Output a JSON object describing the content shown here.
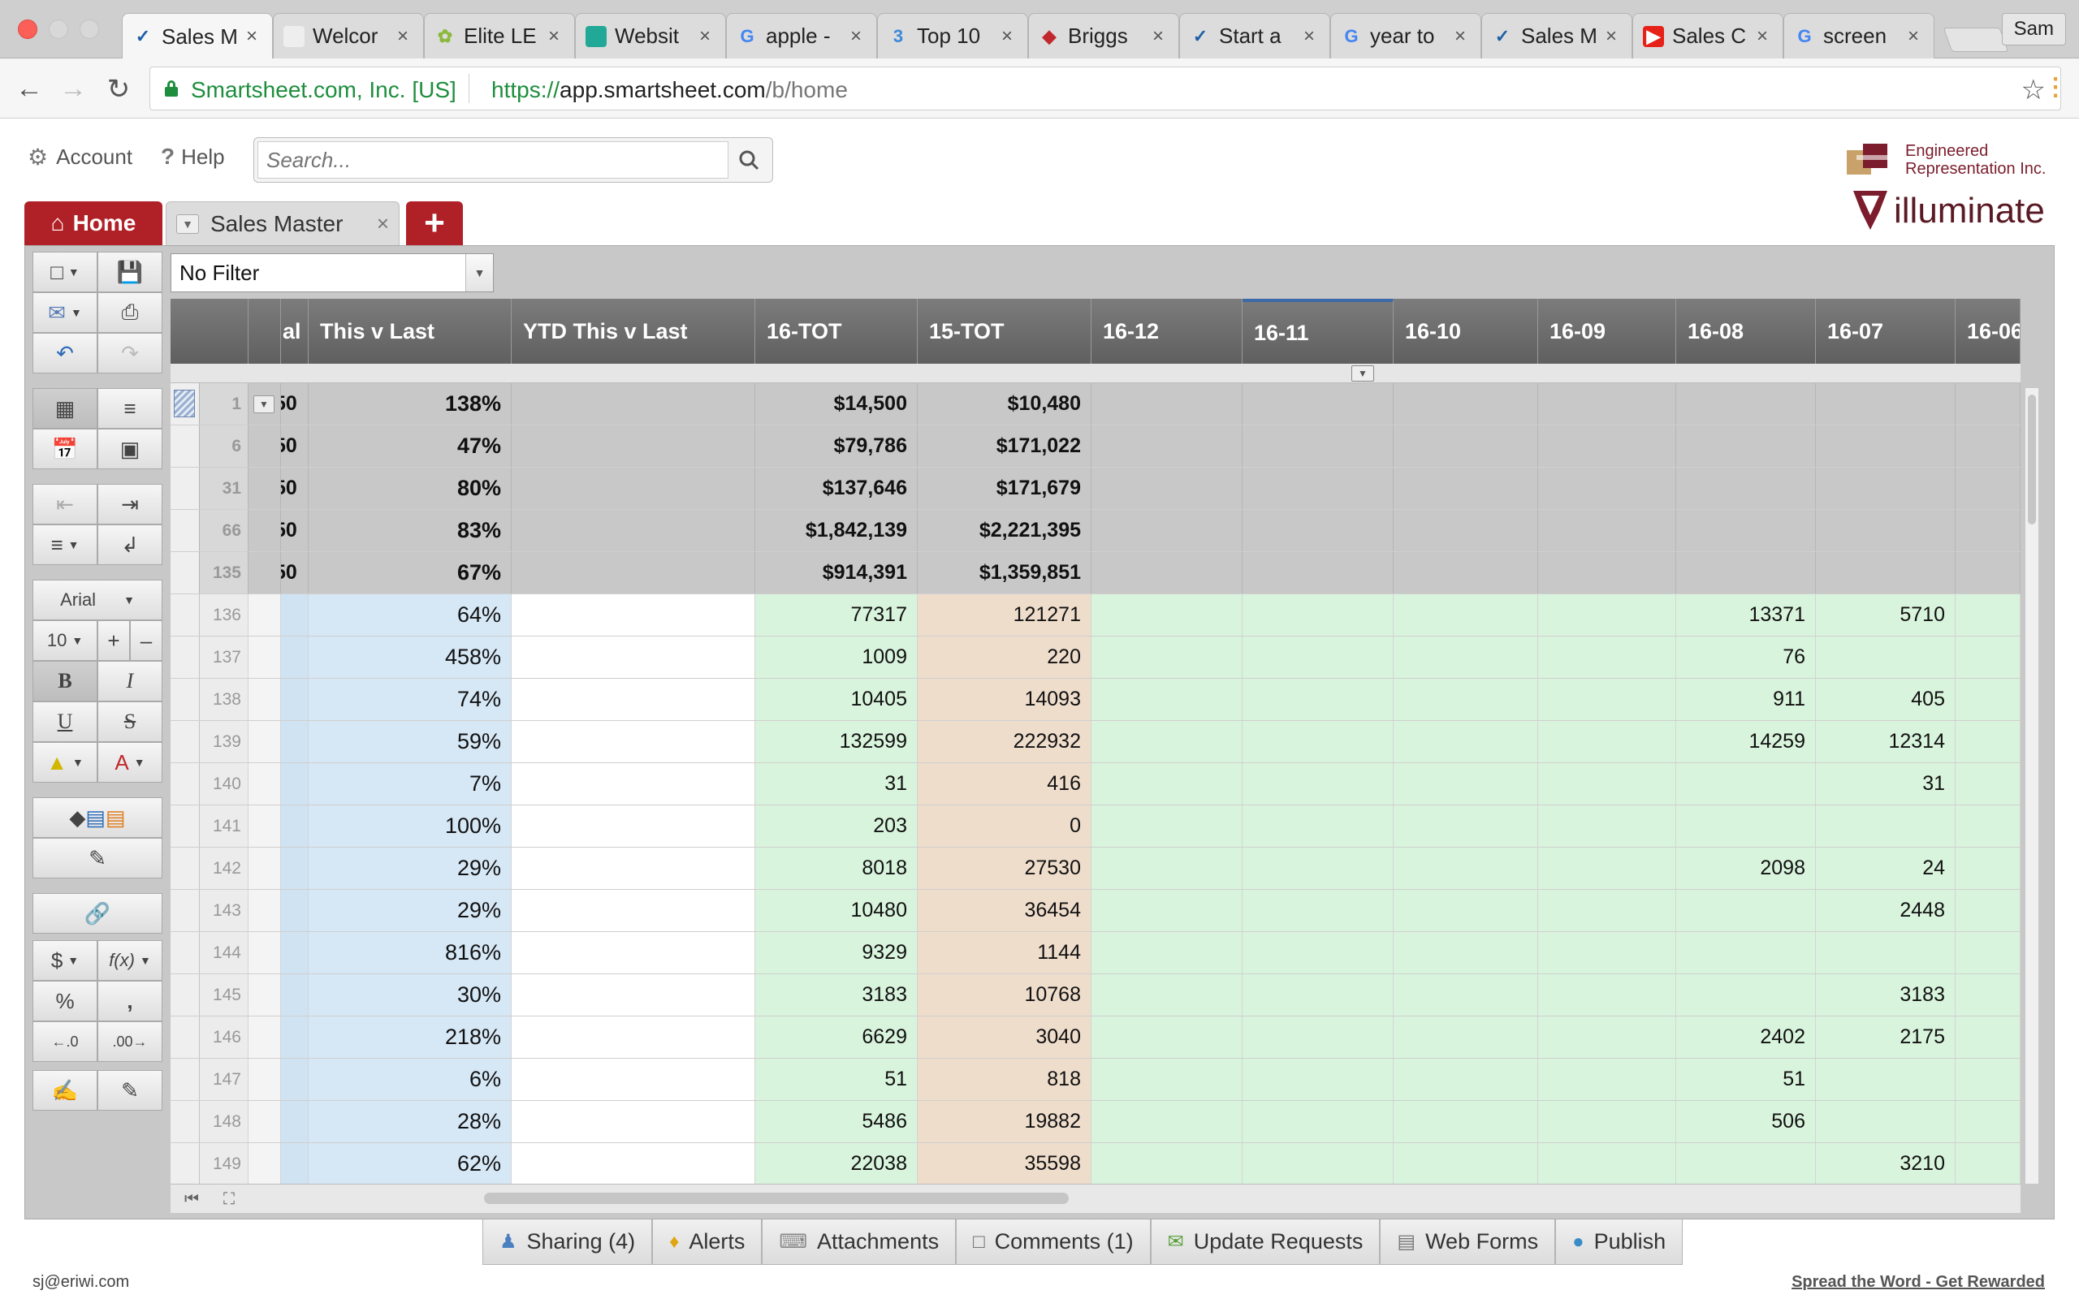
{
  "browser": {
    "tabs": [
      {
        "title": "Sales M",
        "icon": "smartsheet-check-icon"
      },
      {
        "title": "Welcor",
        "icon": "blank-page-icon"
      },
      {
        "title": "Elite LE",
        "icon": "leaf-icon"
      },
      {
        "title": "Websit",
        "icon": "teal-square-icon"
      },
      {
        "title": "apple -",
        "icon": "google-g-icon"
      },
      {
        "title": "Top 10",
        "icon": "three-icon"
      },
      {
        "title": "Briggs",
        "icon": "briggs-logo-icon"
      },
      {
        "title": "Start a",
        "icon": "smartsheet-check-icon"
      },
      {
        "title": "year to",
        "icon": "google-g-icon"
      },
      {
        "title": "Sales M",
        "icon": "smartsheet-check-icon"
      },
      {
        "title": "Sales C",
        "icon": "youtube-icon"
      },
      {
        "title": "screen",
        "icon": "google-g-icon"
      }
    ],
    "profile": "Sam",
    "secure_label": "Smartsheet.com, Inc. [US]",
    "url_scheme": "https://",
    "url_host": "app.smartsheet.com",
    "url_path": "/b/home"
  },
  "app": {
    "account_label": "Account",
    "help_label": "Help",
    "search_placeholder": "Search...",
    "logo_line1": "Engineered",
    "logo_line2": "Representation Inc.",
    "logo2_text": "illuminate",
    "home_tab": "Home",
    "sheet_tab": "Sales Master",
    "filter_label": "No Filter"
  },
  "toolbar": {
    "font_name": "Arial",
    "font_size": "10"
  },
  "grid": {
    "columns": {
      "al": "al",
      "this_v_last": "This v Last",
      "ytd_this_v_last": "YTD This v Last",
      "tot16": "16-TOT",
      "tot15": "15-TOT",
      "m1612": "16-12",
      "m1611": "16-11",
      "m1610": "16-10",
      "m1609": "16-09",
      "m1608": "16-08",
      "m1607": "16-07",
      "m1606": "16-06"
    },
    "summary_rows": [
      {
        "num": "1",
        "clip": "50",
        "pct": "138%",
        "tot16": "$14,500",
        "tot15": "$10,480"
      },
      {
        "num": "6",
        "clip": "50",
        "pct": "47%",
        "tot16": "$79,786",
        "tot15": "$171,022"
      },
      {
        "num": "31",
        "clip": "50",
        "pct": "80%",
        "tot16": "$137,646",
        "tot15": "$171,679"
      },
      {
        "num": "66",
        "clip": "50",
        "pct": "83%",
        "tot16": "$1,842,139",
        "tot15": "$2,221,395"
      },
      {
        "num": "135",
        "clip": "50",
        "pct": "67%",
        "tot16": "$914,391",
        "tot15": "$1,359,851"
      }
    ],
    "data_rows": [
      {
        "num": "136",
        "pct": "64%",
        "tot16": "77317",
        "tot15": "121271",
        "m1608": "13371",
        "m1607": "5710"
      },
      {
        "num": "137",
        "pct": "458%",
        "tot16": "1009",
        "tot15": "220",
        "m1608": "76",
        "m1607": ""
      },
      {
        "num": "138",
        "pct": "74%",
        "tot16": "10405",
        "tot15": "14093",
        "m1608": "911",
        "m1607": "405"
      },
      {
        "num": "139",
        "pct": "59%",
        "tot16": "132599",
        "tot15": "222932",
        "m1608": "14259",
        "m1607": "12314"
      },
      {
        "num": "140",
        "pct": "7%",
        "tot16": "31",
        "tot15": "416",
        "m1608": "",
        "m1607": "31"
      },
      {
        "num": "141",
        "pct": "100%",
        "tot16": "203",
        "tot15": "0",
        "m1608": "",
        "m1607": ""
      },
      {
        "num": "142",
        "pct": "29%",
        "tot16": "8018",
        "tot15": "27530",
        "m1608": "2098",
        "m1607": "24"
      },
      {
        "num": "143",
        "pct": "29%",
        "tot16": "10480",
        "tot15": "36454",
        "m1608": "",
        "m1607": "2448"
      },
      {
        "num": "144",
        "pct": "816%",
        "tot16": "9329",
        "tot15": "1144",
        "m1608": "",
        "m1607": ""
      },
      {
        "num": "145",
        "pct": "30%",
        "tot16": "3183",
        "tot15": "10768",
        "m1608": "",
        "m1607": "3183"
      },
      {
        "num": "146",
        "pct": "218%",
        "tot16": "6629",
        "tot15": "3040",
        "m1608": "2402",
        "m1607": "2175"
      },
      {
        "num": "147",
        "pct": "6%",
        "tot16": "51",
        "tot15": "818",
        "m1608": "51",
        "m1607": ""
      },
      {
        "num": "148",
        "pct": "28%",
        "tot16": "5486",
        "tot15": "19882",
        "m1608": "506",
        "m1607": ""
      },
      {
        "num": "149",
        "pct": "62%",
        "tot16": "22038",
        "tot15": "35598",
        "m1608": "",
        "m1607": "3210"
      }
    ]
  },
  "footer": {
    "tabs": [
      {
        "label": "Sharing (4)",
        "icon": "people-icon"
      },
      {
        "label": "Alerts",
        "icon": "bell-icon"
      },
      {
        "label": "Attachments",
        "icon": "paperclip-icon"
      },
      {
        "label": "Comments (1)",
        "icon": "speech-bubble-icon"
      },
      {
        "label": "Update Requests",
        "icon": "update-request-icon"
      },
      {
        "label": "Web Forms",
        "icon": "form-icon"
      },
      {
        "label": "Publish",
        "icon": "globe-icon"
      }
    ],
    "email": "sj@eriwi.com",
    "spread_link": "Spread the Word - Get Rewarded"
  },
  "colors": {
    "brand_red": "#b02127",
    "secure_green": "#1e8e3e",
    "col_blue": "#d6e7f5",
    "col_green": "#d9f4dd",
    "col_tan": "#efddcc"
  }
}
